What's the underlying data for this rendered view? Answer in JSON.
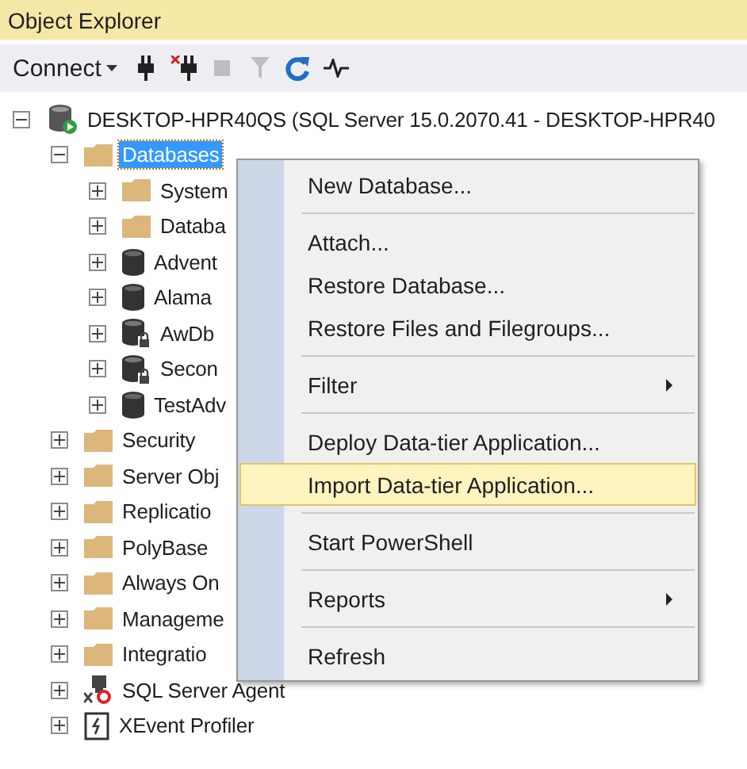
{
  "panel": {
    "title": "Object Explorer"
  },
  "toolbar": [
    {
      "kind": "connect",
      "label": "Connect",
      "disabled": false
    },
    {
      "kind": "plug",
      "disabled": false
    },
    {
      "kind": "unplug",
      "disabled": false
    },
    {
      "kind": "stop",
      "disabled": true
    },
    {
      "kind": "filter",
      "disabled": true
    },
    {
      "kind": "refresh",
      "disabled": false
    },
    {
      "kind": "activity",
      "disabled": false
    }
  ],
  "tree": [
    {
      "label": "DESKTOP-HPR40QS (SQL Server 15.0.2070.41 - DESKTOP-HPR40",
      "kind": "server",
      "expanded": true,
      "selected": false,
      "children": [
        {
          "label": "Databases",
          "kind": "folder",
          "expanded": true,
          "selected": true,
          "children": [
            {
              "label": "System",
              "kind": "folder",
              "expanded": false,
              "selected": false
            },
            {
              "label": "Databa",
              "kind": "folder",
              "expanded": false,
              "selected": false
            },
            {
              "label": "Advent",
              "kind": "database",
              "expanded": false,
              "selected": false
            },
            {
              "label": "Alama",
              "kind": "database",
              "expanded": false,
              "selected": false
            },
            {
              "label": "AwDb",
              "kind": "locked_database",
              "expanded": false,
              "selected": false
            },
            {
              "label": "Secon",
              "kind": "locked_database",
              "expanded": false,
              "selected": false
            },
            {
              "label": "TestAdv",
              "kind": "database",
              "expanded": false,
              "selected": false
            }
          ]
        },
        {
          "label": "Security",
          "kind": "folder",
          "expanded": false,
          "selected": false
        },
        {
          "label": "Server Obj",
          "kind": "folder",
          "expanded": false,
          "selected": false
        },
        {
          "label": "Replicatio",
          "kind": "folder",
          "expanded": false,
          "selected": false
        },
        {
          "label": "PolyBase",
          "kind": "folder",
          "expanded": false,
          "selected": false
        },
        {
          "label": "Always On",
          "kind": "folder",
          "expanded": false,
          "selected": false
        },
        {
          "label": "Manageme",
          "kind": "folder",
          "expanded": false,
          "selected": false
        },
        {
          "label": "Integratio",
          "kind": "folder",
          "expanded": false,
          "selected": false
        },
        {
          "label": "SQL Server Agent",
          "kind": "agent",
          "expanded": false,
          "selected": false
        },
        {
          "label": "XEvent Profiler",
          "kind": "profiler",
          "expanded": false,
          "selected": false
        }
      ]
    }
  ],
  "context_menu": {
    "groups": [
      [
        {
          "label": "New Database...",
          "selected": false,
          "submenu": false
        }
      ],
      [
        {
          "label": "Attach...",
          "selected": false,
          "submenu": false
        },
        {
          "label": "Restore Database...",
          "selected": false,
          "submenu": false
        },
        {
          "label": "Restore Files and Filegroups...",
          "selected": false,
          "submenu": false
        }
      ],
      [
        {
          "label": "Filter",
          "selected": false,
          "submenu": true
        }
      ],
      [
        {
          "label": "Deploy Data-tier Application...",
          "selected": false,
          "submenu": false
        },
        {
          "label": "Import Data-tier Application...",
          "selected": true,
          "submenu": false
        }
      ],
      [
        {
          "label": "Start PowerShell",
          "selected": false,
          "submenu": false
        }
      ],
      [
        {
          "label": "Reports",
          "selected": false,
          "submenu": true
        }
      ],
      [
        {
          "label": "Refresh",
          "selected": false,
          "submenu": false
        }
      ]
    ]
  }
}
